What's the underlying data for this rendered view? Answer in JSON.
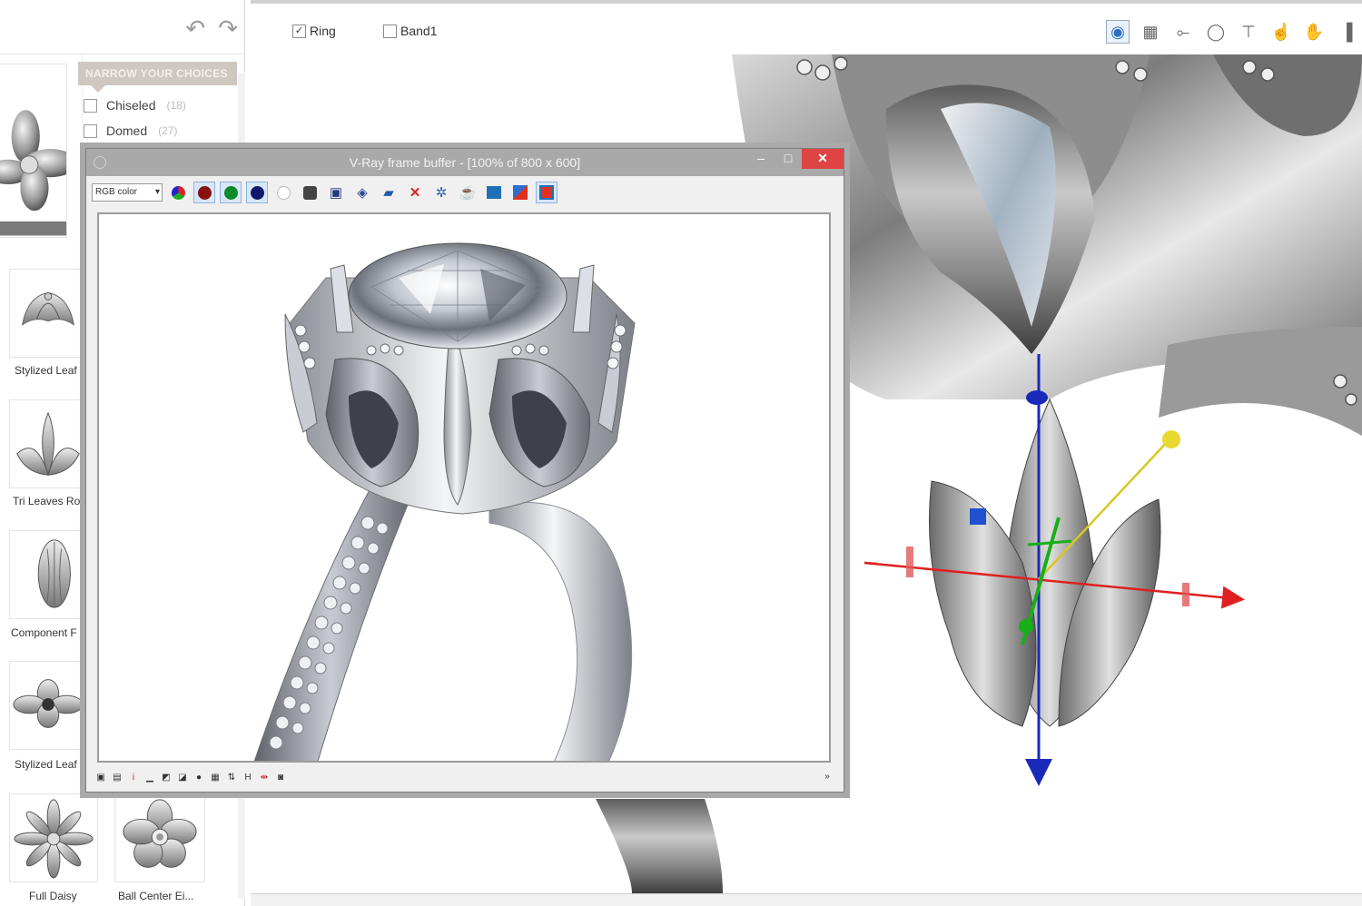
{
  "library": {
    "undo_icon": "undo-icon",
    "redo_icon": "redo-icon",
    "filter_title": "NARROW YOUR CHOICES",
    "filters": [
      {
        "label": "Chiseled",
        "count": "(18)",
        "checked": false
      },
      {
        "label": "Domed",
        "count": "(27)",
        "checked": false
      }
    ],
    "items": [
      {
        "label": "Stylized Leaf"
      },
      {
        "label": "Tri Leaves Ro"
      },
      {
        "label": "Component F"
      },
      {
        "label": "Stylized Leaf"
      },
      {
        "label": "Full Daisy"
      },
      {
        "label": "Ball Center Ei..."
      }
    ]
  },
  "viewport": {
    "tabs": [
      {
        "label": "Ring",
        "checked": true,
        "check_mark": "✓"
      },
      {
        "label": "Band1",
        "checked": false,
        "check_mark": ""
      }
    ],
    "tools": [
      "render-view-icon",
      "layout-icon",
      "move-icon",
      "rotate-icon",
      "scale-icon",
      "select-hand-icon",
      "pan-hand-icon",
      "more-icon"
    ]
  },
  "vfb": {
    "title": "V-Ray frame buffer - [100% of 800 x 600]",
    "minimize": "–",
    "maximize": "□",
    "close": "✕",
    "channel": "RGB color",
    "toolbar": [
      "rgb-channels-icon",
      "red-channel-icon",
      "green-channel-icon",
      "blue-channel-icon",
      "alpha-channel-icon",
      "mono-icon",
      "save-icon",
      "save-all-icon",
      "load-icon",
      "clear-icon",
      "region-render-icon",
      "render-icon",
      "stamp-icon",
      "lens-effects-icon",
      "history-icon"
    ],
    "bottom_tools": [
      "display-correction-icon",
      "levels-icon",
      "info-icon",
      "histogram-icon",
      "color-clamp-icon",
      "sRGB-icon",
      "lut-icon",
      "ocio-icon",
      "h-icon",
      "compare-icon",
      "pixel-aspect-icon",
      "lock-icon"
    ],
    "bottom_collapse": "»"
  },
  "colors": {
    "axis_x": "#e02020",
    "axis_y": "#18b018",
    "axis_z": "#1a2ab8",
    "axis_free": "#e0d020",
    "close_red": "#e04343",
    "filter_header": "#cfc8c0"
  }
}
